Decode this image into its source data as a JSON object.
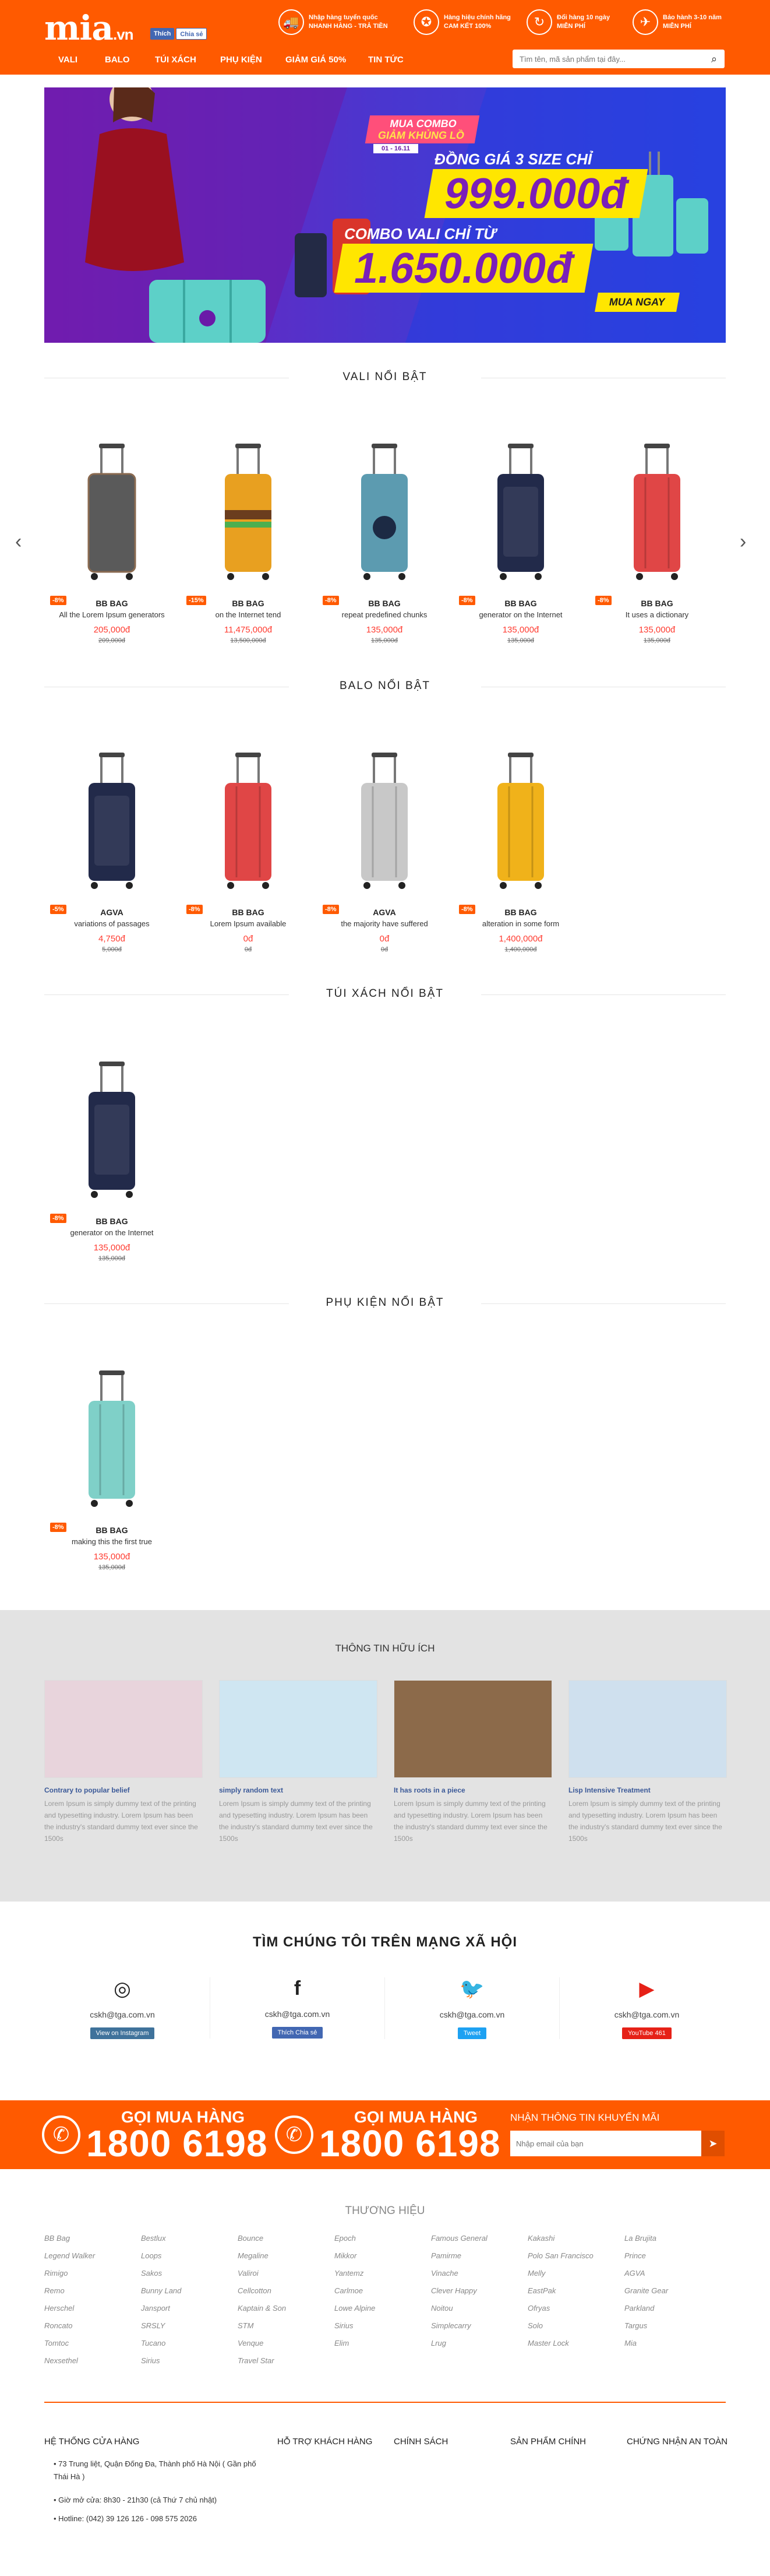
{
  "header": {
    "logo_main": "mia",
    "logo_suffix": ".vn",
    "fb_like": "Thích",
    "fb_share": "Chia sẻ",
    "features": [
      {
        "icon": "truck-icon",
        "glyph": "🚚",
        "line1": "Nhập hàng tuyển quốc",
        "line2": "NHANH HÀNG - TRẢ TIỀN"
      },
      {
        "icon": "badge-icon",
        "glyph": "✪",
        "line1": "Hàng hiệu chính hãng",
        "line2": "CAM KẾT 100%"
      },
      {
        "icon": "return-icon",
        "glyph": "↻",
        "line1": "Đổi hàng 10 ngày",
        "line2": "MIỄN PHÍ"
      },
      {
        "icon": "warranty-icon",
        "glyph": "✈",
        "line1": "Bảo hành 3-10 năm",
        "line2": "MIỄN PHÍ"
      }
    ]
  },
  "nav": [
    "VALI",
    "BALO",
    "TÚI XÁCH",
    "PHỤ KIỆN",
    "GIẢM GIÁ 50%",
    "TIN TỨC"
  ],
  "search": {
    "placeholder": "Tìm tên, mã sản phẩm tại đây..."
  },
  "banner": {
    "tag1": "MUA COMBO",
    "tag2": "GIẢM KHỦNG LỒ",
    "date": "01 - 16.11",
    "line1": "ĐỒNG GIÁ 3 SIZE CHỈ",
    "price1": "999.000đ",
    "line2": "COMBO VALI CHỈ TỪ",
    "price2": "1.650.000đ",
    "cta": "MUA NGAY"
  },
  "sections": [
    {
      "title": "VALI NỔI BẬT",
      "products": [
        {
          "disc": "-8%",
          "brand": "BB BAG",
          "name": "All the Lorem Ipsum generators",
          "price": "205,000đ",
          "old": "209,000đ",
          "color": "#5a5a5a",
          "pattern": "dots"
        },
        {
          "disc": "-15%",
          "brand": "BB BAG",
          "name": "on the Internet tend",
          "price": "11,475,000đ",
          "old": "13,500,000đ",
          "color": "#e8a020",
          "pattern": "burger"
        },
        {
          "disc": "-8%",
          "brand": "BB BAG",
          "name": "repeat predefined chunks",
          "price": "135,000đ",
          "old": "135,000đ",
          "color": "#5c9bb0",
          "pattern": "art"
        },
        {
          "disc": "-8%",
          "brand": "BB BAG",
          "name": "generator on the Internet",
          "price": "135,000đ",
          "old": "135,000đ",
          "color": "#222a4a",
          "pattern": "soft"
        },
        {
          "disc": "-8%",
          "brand": "BB BAG",
          "name": "It uses a dictionary",
          "price": "135,000đ",
          "old": "135,000đ",
          "color": "#e04646",
          "pattern": "hard"
        }
      ]
    },
    {
      "title": "BALO NỔI BẬT",
      "products": [
        {
          "disc": "-5%",
          "brand": "AGVA",
          "name": "variations of passages",
          "price": "4,750đ",
          "old": "5,000đ",
          "color": "#222a4a",
          "pattern": "soft"
        },
        {
          "disc": "-8%",
          "brand": "BB BAG",
          "name": "Lorem Ipsum available",
          "price": "0đ",
          "old": "0đ",
          "color": "#e04646",
          "pattern": "hard"
        },
        {
          "disc": "-8%",
          "brand": "AGVA",
          "name": "the majority have suffered",
          "price": "0đ",
          "old": "0đ",
          "color": "#c8c8c8",
          "pattern": "hard"
        },
        {
          "disc": "-8%",
          "brand": "BB BAG",
          "name": "alteration in some form",
          "price": "1,400,000đ",
          "old": "1,400,000đ",
          "color": "#f0b21a",
          "pattern": "hard"
        }
      ]
    },
    {
      "title": "TÚI XÁCH NỔI BẬT",
      "products": [
        {
          "disc": "-8%",
          "brand": "BB BAG",
          "name": "generator on the Internet",
          "price": "135,000đ",
          "old": "135,000đ",
          "color": "#222a4a",
          "pattern": "soft"
        }
      ]
    },
    {
      "title": "PHỤ KIỆN NỔI BẬT",
      "products": [
        {
          "disc": "-8%",
          "brand": "BB BAG",
          "name": "making this the first true",
          "price": "135,000đ",
          "old": "135,000đ",
          "color": "#7fd0c8",
          "pattern": "frame"
        }
      ]
    }
  ],
  "news": {
    "title": "THÔNG TIN HỮU ÍCH",
    "items": [
      {
        "title": "Contrary to popular belief",
        "text": "Lorem Ipsum is simply dummy text of the printing and typesetting industry. Lorem Ipsum has been the industry's standard dummy text ever since the 1500s",
        "color": "#e8d4dc"
      },
      {
        "title": "simply random text",
        "text": "Lorem Ipsum is simply dummy text of the printing and typesetting industry. Lorem Ipsum has been the industry's standard dummy text ever since the 1500s",
        "color": "#cfe6f2"
      },
      {
        "title": "It has roots in a piece",
        "text": "Lorem Ipsum is simply dummy text of the printing and typesetting industry. Lorem Ipsum has been the industry's standard dummy text ever since the 1500s",
        "color": "#8c6a4a"
      },
      {
        "title": "Lisp Intensive Treatment",
        "text": "Lorem Ipsum is simply dummy text of the printing and typesetting industry. Lorem Ipsum has been the industry's standard dummy text ever since the 1500s",
        "color": "#cfe0ee"
      }
    ]
  },
  "social": {
    "title": "TÌM CHÚNG TÔI TRÊN MẠNG XÃ HỘI",
    "items": [
      {
        "icon": "instagram-icon",
        "glyph": "◎",
        "email": "cskh@tga.com.vn",
        "btn": "View on Instagram",
        "btncolor": "#3f729b"
      },
      {
        "icon": "facebook-icon",
        "glyph": "f",
        "email": "cskh@tga.com.vn",
        "btn": "Thích  Chia sẻ",
        "btncolor": "#4267b2"
      },
      {
        "icon": "twitter-icon",
        "glyph": "🐦",
        "email": "cskh@tga.com.vn",
        "btn": "Tweet",
        "btncolor": "#1da1f2"
      },
      {
        "icon": "youtube-icon",
        "glyph": "▶",
        "email": "cskh@tga.com.vn",
        "btn": "YouTube  461",
        "btncolor": "#e62117"
      }
    ]
  },
  "hotline": {
    "label": "GỌI MUA HÀNG",
    "number": "1800 6198",
    "promo_title": "NHẬN THÔNG TIN KHUYẾN MÃI",
    "email_placeholder": "Nhập email của bạn"
  },
  "brands": {
    "title": "THƯƠNG HIỆU",
    "columns": [
      [
        "BB Bag",
        "Legend Walker",
        "Rimigo",
        "Remo",
        "Herschel",
        "Roncato",
        "Tomtoc",
        "Nexsethel"
      ],
      [
        "Bestlux",
        "Loops",
        "Sakos",
        "Bunny Land",
        "Jansport",
        "SRSLY",
        "Tucano",
        "Sirius"
      ],
      [
        "Bounce",
        "Megaline",
        "Valiroi",
        "Cellcotton",
        "Kaptain & Son",
        "STM",
        "Venque",
        "Travel Star"
      ],
      [
        "Epoch",
        "Mikkor",
        "Yantemz",
        "Carlmoe",
        "Lowe Alpine",
        "Sirius",
        "Elim"
      ],
      [
        "Famous General",
        "Pamirme",
        "Vinache",
        "Clever Happy",
        "Noitou",
        "Simplecarry",
        "Lrug"
      ],
      [
        "Kakashi",
        "Polo San Francisco",
        "Melly",
        "EastPak",
        "Ofryas",
        "Solo",
        "Master Lock"
      ],
      [
        "La Brujita",
        "Prince",
        "AGVA",
        "Granite Gear",
        "Parkland",
        "Targus",
        "Mia"
      ]
    ]
  },
  "footer": {
    "heads": [
      "HỆ THỐNG CỬA HÀNG",
      "HỖ TRỢ KHÁCH HÀNG",
      "CHÍNH SÁCH",
      "SẢN PHẨM CHÍNH",
      "CHỨNG NHẬN AN TOÀN"
    ],
    "lines": [
      "73 Trung liệt, Quận Đống Đa, Thành phố Hà Nội ( Gần phố Thái Hà )",
      "Giờ mở cửa: 8h30 - 21h30 (cả Thứ 7 chủ nhật)",
      "Hotline: (042) 39 126 126 - 098 575 2026"
    ]
  },
  "colors": {
    "brand": "#ff5a00",
    "price": "#ff3b30"
  }
}
